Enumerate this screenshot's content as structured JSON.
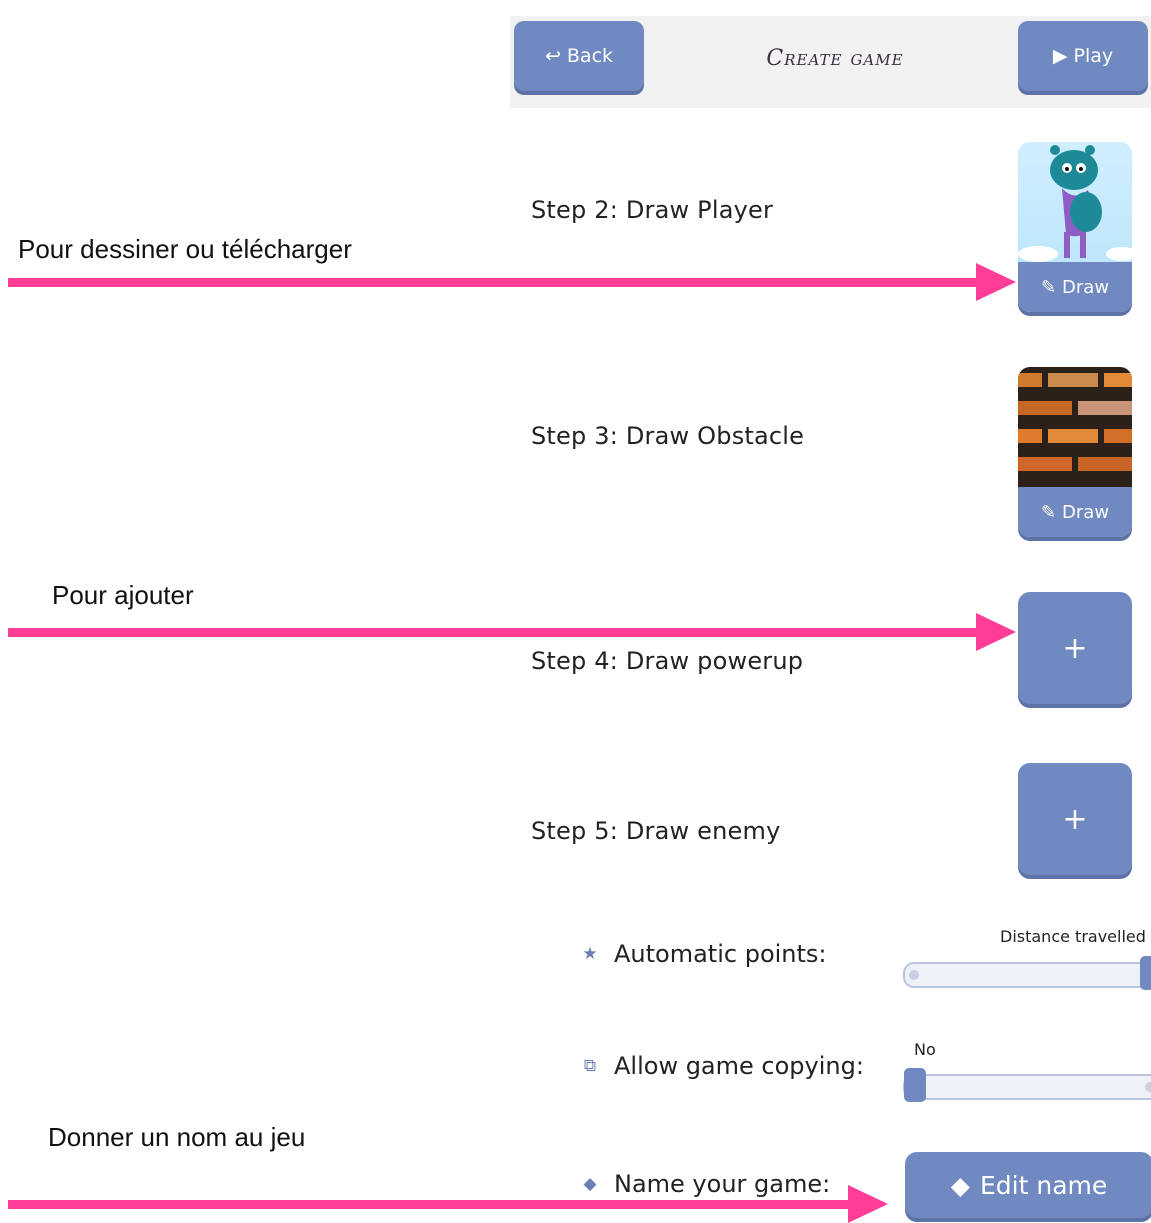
{
  "header": {
    "back_label": "Back",
    "title": "Create game",
    "play_label": "Play"
  },
  "steps": [
    {
      "label": "Step 2: Draw Player",
      "button": "Draw"
    },
    {
      "label": "Step 3: Draw Obstacle",
      "button": "Draw"
    },
    {
      "label": "Step 4: Draw powerup",
      "button": "+"
    },
    {
      "label": "Step 5: Draw enemy",
      "button": "+"
    }
  ],
  "options": {
    "automatic_points": {
      "label": "Automatic points:",
      "value_caption": "Distance travelled",
      "icon": "star-icon"
    },
    "allow_copying": {
      "label": "Allow game copying:",
      "value_caption": "No",
      "icon": "copy-icon"
    },
    "name_game": {
      "label": "Name your game:",
      "button": "Edit name",
      "icon": "tag-icon"
    }
  },
  "annotations": {
    "draw_note": "Pour dessiner ou télécharger",
    "add_note": "Pour ajouter",
    "name_note": "Donner un nom au jeu"
  },
  "colors": {
    "button_blue": "#7089c0",
    "arrow_pink": "#ff3c96",
    "header_bg": "#f2f2f2"
  }
}
